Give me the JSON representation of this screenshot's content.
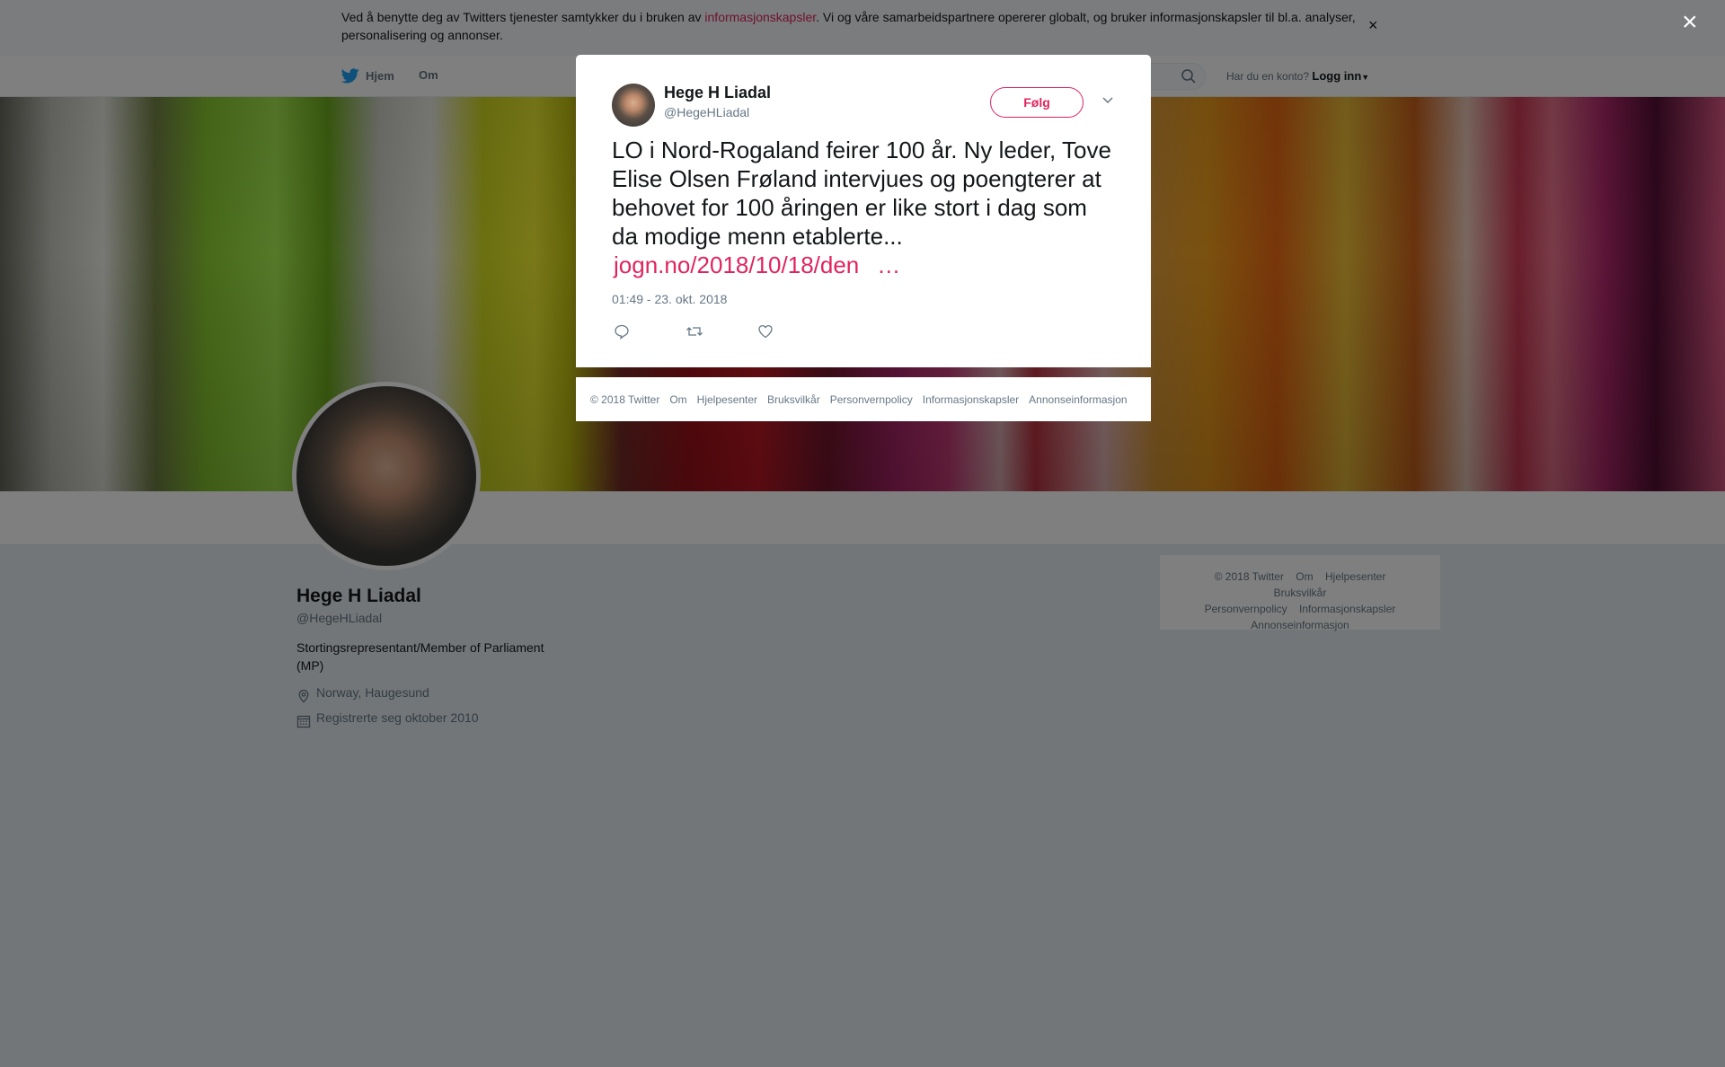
{
  "cookie_banner": {
    "text_before": "Ved å benytte deg av Twitters tjenester samtykker du i bruken av ",
    "link": "informasjonskapsler",
    "text_after": ". Vi og våre samarbeidspartnere opererer globalt, og bruker informasjonskapsler til bl.a. analyser, personalisering og annonser.",
    "close": "×"
  },
  "nav": {
    "home": "Hjem",
    "about": "Om",
    "login_prompt": "Har du en konto?",
    "login": "Logg inn"
  },
  "profile": {
    "name": "Hege H Liadal",
    "handle": "@HegeHLiadal",
    "bio": "Stortingsrepresentant/Member of Parliament (MP)",
    "location": "Norway, Haugesund",
    "joined": "Registrerte seg oktober 2010"
  },
  "side_footer": [
    "© 2018 Twitter",
    "Om",
    "Hjelpesenter",
    "Bruksvilkår",
    "Personvernpolicy",
    "Informasjonskapsler",
    "Annonseinformasjon"
  ],
  "tweet": {
    "author_name": "Hege H Liadal",
    "author_handle": "@HegeHLiadal",
    "follow_label": "Følg",
    "text": "LO i Nord-Rogaland feirer 100 år. Ny leder, Tove Elise Olsen Frøland intervjues og poengterer at behovet for 100 åringen er like stort i dag som da modige menn etablerte...",
    "link": "jogn.no/2018/10/18/den",
    "link_ellipsis": "…",
    "timestamp": "01:49 - 23. okt. 2018"
  },
  "modal_footer": [
    "© 2018 Twitter",
    "Om",
    "Hjelpesenter",
    "Bruksvilkår",
    "Personvernpolicy",
    "Informasjonskapsler",
    "Annonseinformasjon"
  ],
  "overlay_close": "×",
  "colors": {
    "accent": "#e0245e",
    "twitter_blue": "#1da1f2",
    "muted": "#657786"
  }
}
